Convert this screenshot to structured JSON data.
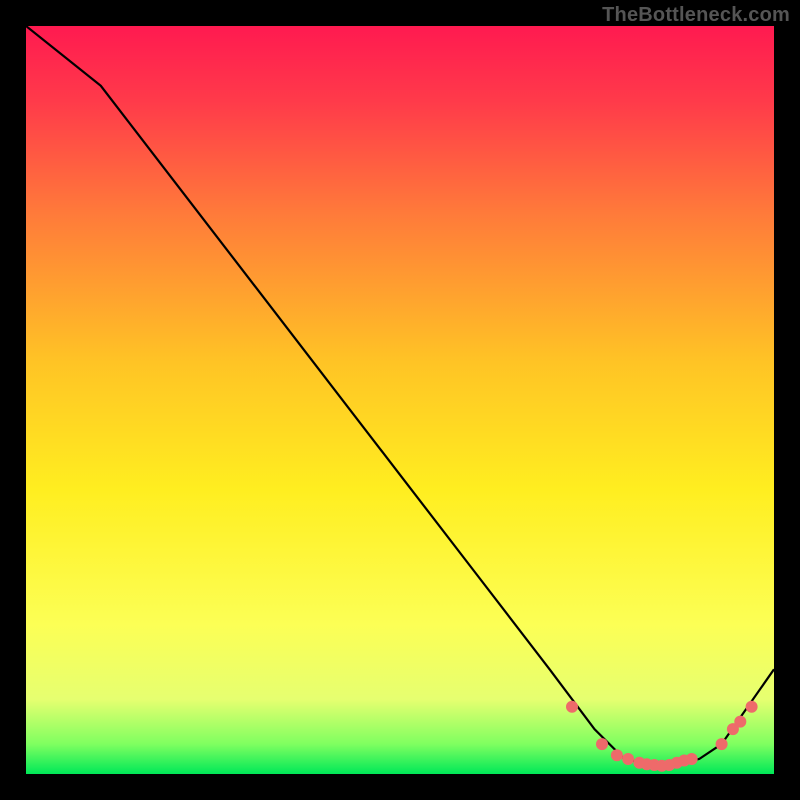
{
  "watermark": "TheBottleneck.com",
  "chart_data": {
    "type": "line",
    "title": "",
    "xlabel": "",
    "ylabel": "",
    "xlim": [
      0,
      100
    ],
    "ylim": [
      0,
      100
    ],
    "grid": false,
    "legend": false,
    "background_gradient_stops": [
      {
        "offset": 0.0,
        "color": "#ff1a50"
      },
      {
        "offset": 0.1,
        "color": "#ff3a4a"
      },
      {
        "offset": 0.25,
        "color": "#ff7a3a"
      },
      {
        "offset": 0.45,
        "color": "#ffc425"
      },
      {
        "offset": 0.62,
        "color": "#ffee20"
      },
      {
        "offset": 0.8,
        "color": "#fcff55"
      },
      {
        "offset": 0.9,
        "color": "#e6ff70"
      },
      {
        "offset": 0.96,
        "color": "#7fff60"
      },
      {
        "offset": 1.0,
        "color": "#00e858"
      }
    ],
    "series": [
      {
        "name": "curve",
        "x": [
          0,
          10,
          20,
          30,
          40,
          50,
          60,
          70,
          76,
          80,
          85,
          90,
          93,
          100
        ],
        "y": [
          100,
          92,
          79,
          66,
          53,
          40,
          27,
          14,
          6,
          2,
          1,
          2,
          4,
          14
        ]
      }
    ],
    "markers": {
      "name": "highlight-points",
      "color": "#ee6a6a",
      "radius": 6,
      "points": [
        {
          "x": 73,
          "y": 9
        },
        {
          "x": 77,
          "y": 4
        },
        {
          "x": 79,
          "y": 2.5
        },
        {
          "x": 80.5,
          "y": 2
        },
        {
          "x": 82,
          "y": 1.5
        },
        {
          "x": 83,
          "y": 1.3
        },
        {
          "x": 84,
          "y": 1.2
        },
        {
          "x": 85,
          "y": 1.1
        },
        {
          "x": 86,
          "y": 1.2
        },
        {
          "x": 87,
          "y": 1.5
        },
        {
          "x": 88,
          "y": 1.8
        },
        {
          "x": 89,
          "y": 2
        },
        {
          "x": 93,
          "y": 4
        },
        {
          "x": 94.5,
          "y": 6
        },
        {
          "x": 95.5,
          "y": 7
        },
        {
          "x": 97,
          "y": 9
        }
      ]
    }
  }
}
